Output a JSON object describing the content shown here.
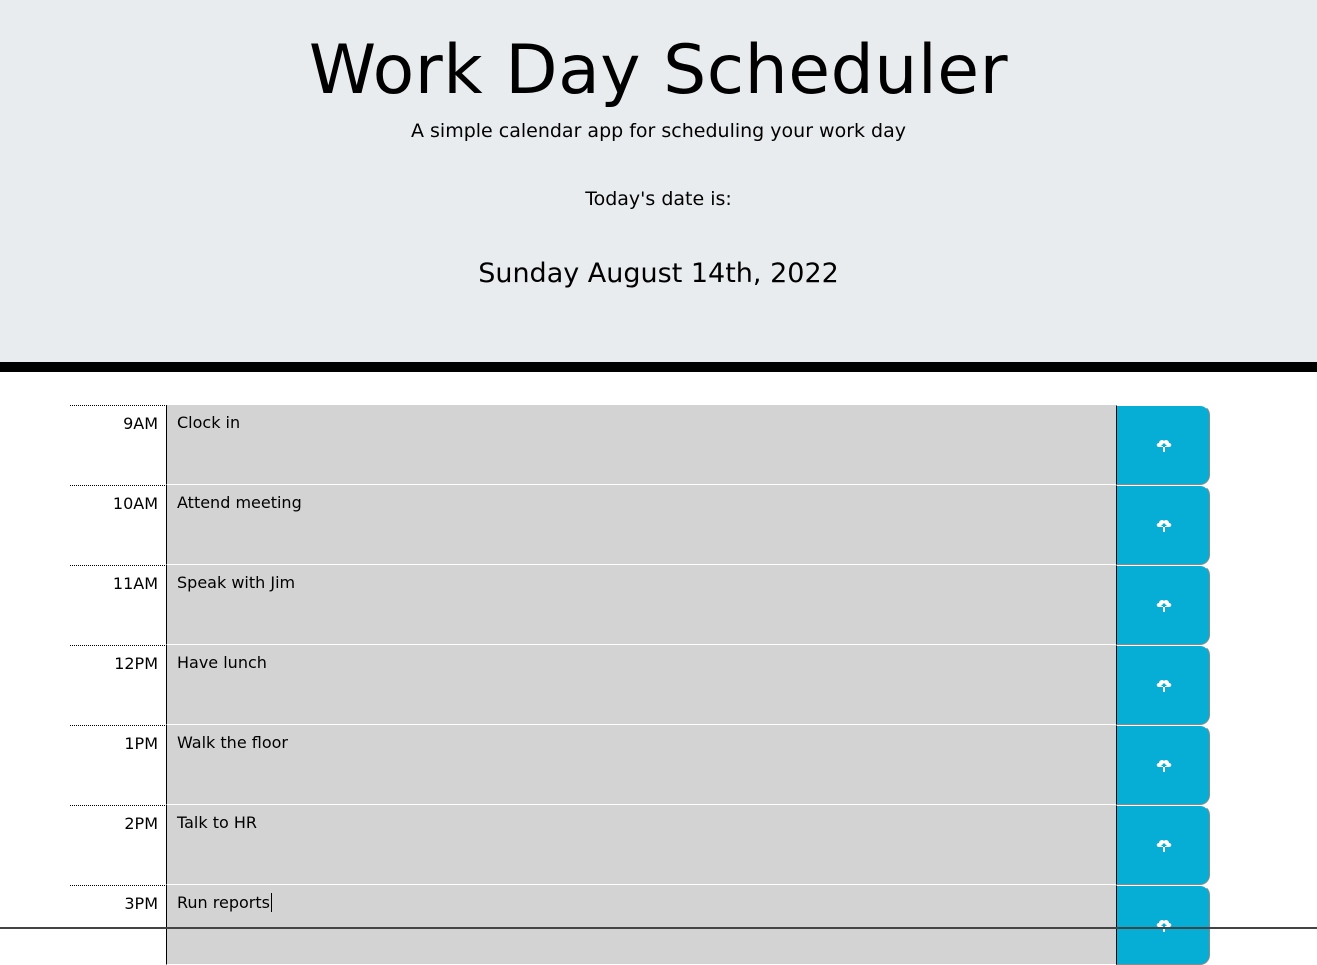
{
  "header": {
    "title": "Work Day Scheduler",
    "subtitle": "A simple calendar app for scheduling your work day",
    "date_label": "Today's date is:",
    "current_day": "Sunday August 14th, 2022"
  },
  "colors": {
    "header_bg": "#e9ecef",
    "past_row_bg": "#d3d3d3",
    "save_button": "#06aed5"
  },
  "rows": [
    {
      "hour": "9AM",
      "text": "Clock in",
      "save_icon": "cloud-upload-icon"
    },
    {
      "hour": "10AM",
      "text": "Attend meeting",
      "save_icon": "cloud-upload-icon"
    },
    {
      "hour": "11AM",
      "text": "Speak with Jim",
      "save_icon": "cloud-upload-icon"
    },
    {
      "hour": "12PM",
      "text": "Have lunch",
      "save_icon": "cloud-upload-icon"
    },
    {
      "hour": "1PM",
      "text": "Walk the floor",
      "save_icon": "cloud-upload-icon"
    },
    {
      "hour": "2PM",
      "text": "Talk to HR",
      "save_icon": "cloud-upload-icon"
    },
    {
      "hour": "3PM",
      "text": "Run reports",
      "save_icon": "cloud-upload-icon"
    }
  ]
}
